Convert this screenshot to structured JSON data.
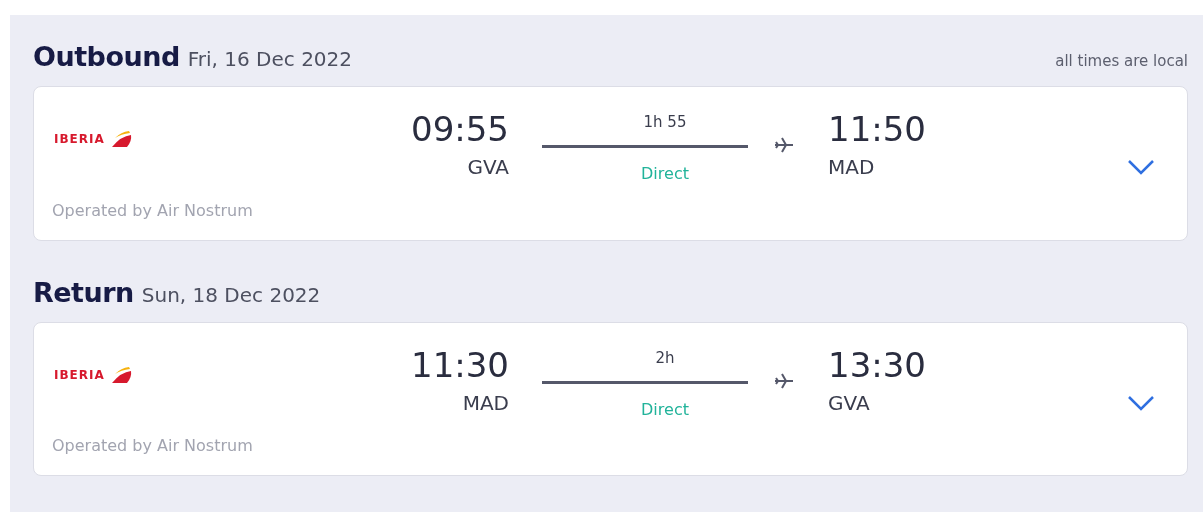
{
  "legs": [
    {
      "title": "Outbound",
      "date": "Fri, 16 Dec 2022",
      "note": "all times are local",
      "airline": "IBERIA",
      "departure_time": "09:55",
      "departure_airport": "GVA",
      "duration": "1h 55",
      "stops": "Direct",
      "arrival_time": "11:50",
      "arrival_airport": "MAD",
      "operator": "Operated by Air Nostrum"
    },
    {
      "title": "Return",
      "date": "Sun, 18 Dec 2022",
      "airline": "IBERIA",
      "departure_time": "11:30",
      "departure_airport": "MAD",
      "duration": "2h",
      "stops": "Direct",
      "arrival_time": "13:30",
      "arrival_airport": "GVA",
      "operator": "Operated by Air Nostrum"
    }
  ]
}
